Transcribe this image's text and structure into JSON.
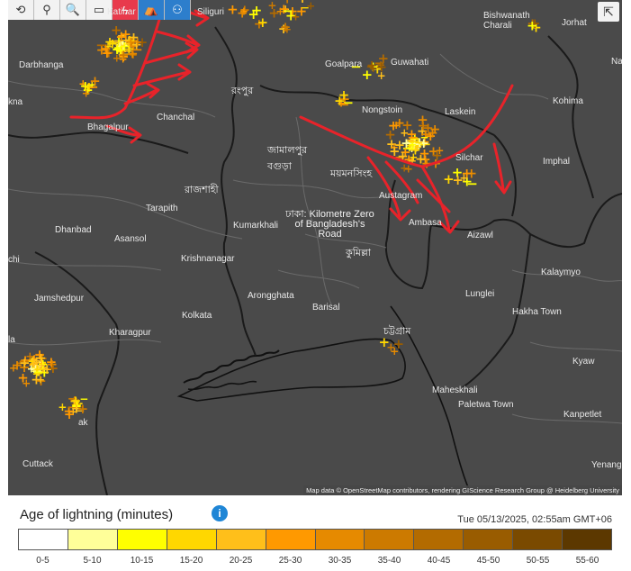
{
  "map": {
    "attribution": "Map data © OpenStreetMap contributors, rendering GIScience Research Group @ Heidelberg University",
    "places": [
      {
        "name": "Siliguri",
        "cls": ""
      },
      {
        "name": "Bishwanath Charali",
        "cls": ""
      },
      {
        "name": "Jorhat",
        "cls": ""
      },
      {
        "name": "Darbhanga",
        "cls": ""
      },
      {
        "name": "Goalpara",
        "cls": ""
      },
      {
        "name": "Guwahati",
        "cls": ""
      },
      {
        "name": "Kohima",
        "cls": ""
      },
      {
        "name": "Katihar",
        "cls": ""
      },
      {
        "name": "রংপুর",
        "cls": "big"
      },
      {
        "name": "Nongstoin",
        "cls": ""
      },
      {
        "name": "Laskein",
        "cls": ""
      },
      {
        "name": "Chanchal",
        "cls": ""
      },
      {
        "name": "Bhagalpur",
        "cls": ""
      },
      {
        "name": "জামালপুর",
        "cls": "big"
      },
      {
        "name": "Silchar",
        "cls": ""
      },
      {
        "name": "Imphal",
        "cls": ""
      },
      {
        "name": "বগুড়া",
        "cls": "big"
      },
      {
        "name": "ময়মনসিংহ",
        "cls": "big"
      },
      {
        "name": "রাজশাহী",
        "cls": "big"
      },
      {
        "name": "Austagram",
        "cls": ""
      },
      {
        "name": "Tarapith",
        "cls": ""
      },
      {
        "name": "ঢাকা: Kilometre Zero of Bangladesh's Road",
        "cls": "big"
      },
      {
        "name": "Ambasa",
        "cls": ""
      },
      {
        "name": "Kumarkhali",
        "cls": ""
      },
      {
        "name": "Dhanbad",
        "cls": ""
      },
      {
        "name": "Asansol",
        "cls": ""
      },
      {
        "name": "Aizawl",
        "cls": ""
      },
      {
        "name": "কুমিল্লা",
        "cls": "big"
      },
      {
        "name": "Krishnanagar",
        "cls": ""
      },
      {
        "name": "Kalaymyo",
        "cls": ""
      },
      {
        "name": "Jamshedpur",
        "cls": ""
      },
      {
        "name": "Arongghata",
        "cls": ""
      },
      {
        "name": "Lunglei",
        "cls": ""
      },
      {
        "name": "Barisal",
        "cls": ""
      },
      {
        "name": "Kolkata",
        "cls": ""
      },
      {
        "name": "Hakha Town",
        "cls": ""
      },
      {
        "name": "Kharagpur",
        "cls": ""
      },
      {
        "name": "চট্টগ্রাম",
        "cls": "big"
      },
      {
        "name": "Kyaw",
        "cls": ""
      },
      {
        "name": "Maheskhali",
        "cls": ""
      },
      {
        "name": "Paletwa Town",
        "cls": ""
      },
      {
        "name": "Kanpetlet",
        "cls": ""
      },
      {
        "name": "Cuttack",
        "cls": ""
      },
      {
        "name": "Yenang",
        "cls": ""
      },
      {
        "name": "Nam",
        "cls": ""
      },
      {
        "name": "chi",
        "cls": ""
      },
      {
        "name": "kna",
        "cls": ""
      },
      {
        "name": "ak",
        "cls": ""
      },
      {
        "name": "la",
        "cls": ""
      },
      {
        "name": "N",
        "cls": ""
      }
    ]
  },
  "legend": {
    "title": "Age of lightning (minutes)",
    "info_icon": "info-icon",
    "timestamp": "Tue 05/13/2025, 02:55am GMT+06",
    "bins": [
      {
        "label": "0-5",
        "color": "#ffffff"
      },
      {
        "label": "5-10",
        "color": "#ffff99"
      },
      {
        "label": "10-15",
        "color": "#ffff00"
      },
      {
        "label": "15-20",
        "color": "#ffd700"
      },
      {
        "label": "20-25",
        "color": "#ffbf1a"
      },
      {
        "label": "25-30",
        "color": "#ff9900"
      },
      {
        "label": "30-35",
        "color": "#e68a00"
      },
      {
        "label": "35-40",
        "color": "#cc7a00"
      },
      {
        "label": "40-45",
        "color": "#b36b00"
      },
      {
        "label": "45-50",
        "color": "#995c00"
      },
      {
        "label": "50-55",
        "color": "#7a4a00"
      },
      {
        "label": "55-60",
        "color": "#5c3800"
      }
    ]
  },
  "toolbar": {
    "icons": [
      "refresh-icon",
      "location-icon",
      "zoom-icon",
      "distance-icon",
      "lightning-icon",
      "hat-icon",
      "bike-icon"
    ],
    "glyphs": [
      "⟲",
      "⚲",
      "🔍",
      "▭",
      "ϟ",
      "⛺",
      "⚇"
    ],
    "share_glyph": "⇱"
  }
}
